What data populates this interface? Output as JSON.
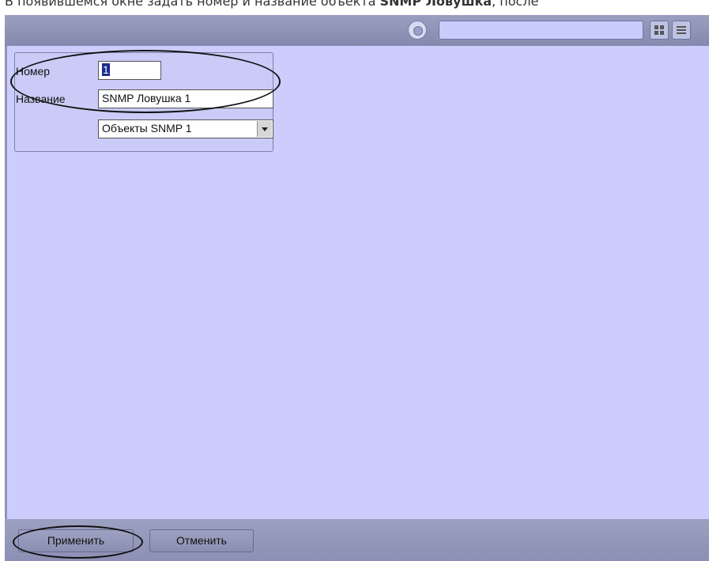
{
  "doc_text": {
    "prefix": "В появившемся окне задать номер и название объекта ",
    "bold": "SNMP Ловушка",
    "suffix": ", после"
  },
  "topbar": {
    "search_value": "",
    "icons": [
      "gear-icon",
      "grid-layout-icon",
      "menu-icon"
    ]
  },
  "form": {
    "number_label": "Номер",
    "number_value": "1",
    "name_label": "Название",
    "name_value": "SNMP Ловушка 1",
    "parent_select_value": "Объекты SNMP 1"
  },
  "buttons": {
    "apply_label": "Применить",
    "cancel_label": "Отменить"
  },
  "colors": {
    "panel_background": "#cccdfc",
    "chrome": "#8f94b6"
  }
}
